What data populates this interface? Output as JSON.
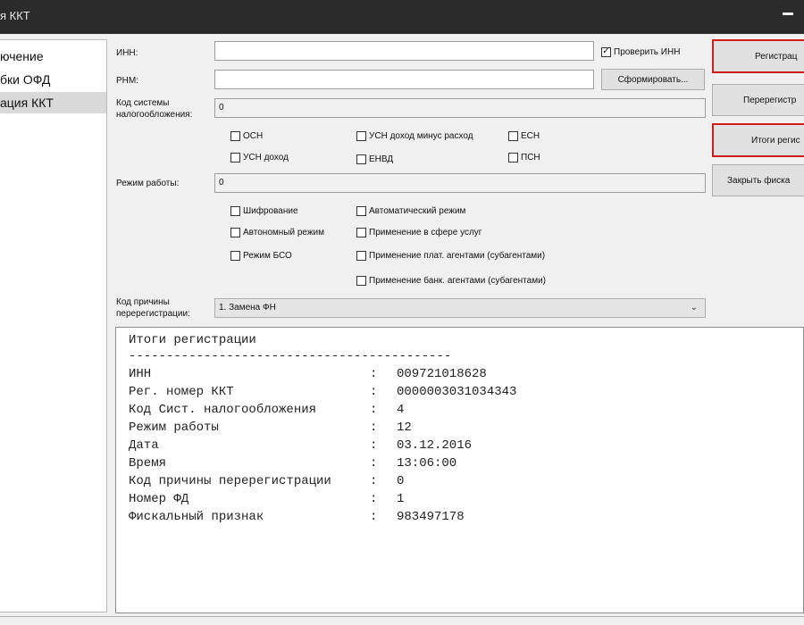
{
  "window": {
    "title": "я ККТ"
  },
  "sidebar": {
    "items": [
      {
        "label": "ючение"
      },
      {
        "label": "бки ОФД"
      },
      {
        "label": "ация ККТ"
      }
    ]
  },
  "form": {
    "inn_label": "ИНН:",
    "inn_value": "",
    "check_inn_label": "Проверить ИНН",
    "rnm_label": "РНМ:",
    "rnm_value": "",
    "generate_button": "Сформировать...",
    "tax_label_line1": "Код системы",
    "tax_label_line2": "налогообложения:",
    "tax_value": "0",
    "tax_options": {
      "osn": "ОСН",
      "usn_income": "УСН доход",
      "usn_income_minus_expense": "УСН доход минус расход",
      "envd": "ЕНВД",
      "esn": "ЕСН",
      "psn": "ПСН"
    },
    "mode_label": "Режим работы:",
    "mode_value": "0",
    "mode_options": {
      "encryption": "Шифрование",
      "autonomous": "Автономный режим",
      "bso": "Режим БСО",
      "automatic": "Автоматический режим",
      "services": "Применение в сфере услуг",
      "payment_agents": "Применение плат. агентами (субагентами)",
      "bank_agents": "Применение банк. агентами (субагентами)"
    },
    "reason_label_line1": "Код причины",
    "reason_label_line2": "перерегистрации:",
    "reason_value": "1. Замена ФН"
  },
  "buttons": {
    "register": "Регистрац",
    "reregister": "Перерегистр",
    "registration_results": "Итоги регис",
    "close_fiscal": "Закрыть фиска"
  },
  "output": {
    "heading": "Итоги регистрации",
    "separator": "-------------------------------------------",
    "rows": [
      {
        "key": "ИНН",
        "value": "009721018628"
      },
      {
        "key": "Рег. номер ККТ",
        "value": "0000003031034343"
      },
      {
        "key": "Код Сист. налогообложения",
        "value": "4"
      },
      {
        "key": "Режим работы",
        "value": "12"
      },
      {
        "key": "Дата",
        "value": "03.12.2016"
      },
      {
        "key": "Время",
        "value": "13:06:00"
      },
      {
        "key": "Код причины перерегистрации",
        "value": "0"
      },
      {
        "key": "Номер ФД",
        "value": "1"
      },
      {
        "key": "Фискальный признак",
        "value": "983497178"
      }
    ],
    "colon": ":"
  },
  "icons": {
    "minimize": "minimize-icon",
    "dropdown": "chevron-down-icon",
    "check": "check-icon"
  }
}
